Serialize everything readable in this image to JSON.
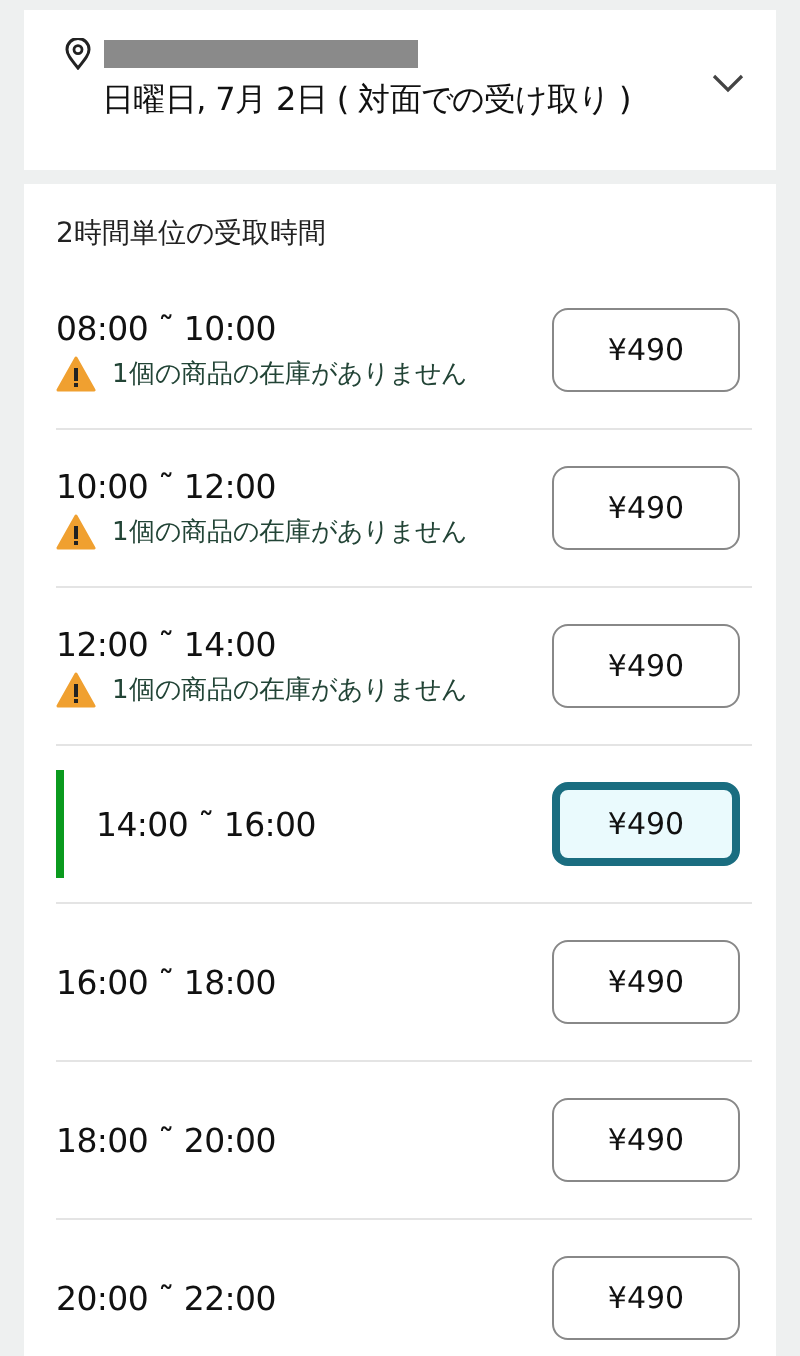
{
  "header": {
    "date": "日曜日, 7月 2日 ( 対面での受け取り )"
  },
  "section_title": "2時間単位の受取時間",
  "slots": [
    {
      "time": "08:00 ˜ 10:00",
      "warning": "1個の商品の在庫がありません",
      "price": "¥490",
      "selected": false
    },
    {
      "time": "10:00 ˜ 12:00",
      "warning": "1個の商品の在庫がありません",
      "price": "¥490",
      "selected": false
    },
    {
      "time": "12:00 ˜ 14:00",
      "warning": "1個の商品の在庫がありません",
      "price": "¥490",
      "selected": false
    },
    {
      "time": "14:00 ˜ 16:00",
      "price": "¥490",
      "selected": true
    },
    {
      "time": "16:00 ˜ 18:00",
      "price": "¥490",
      "selected": false
    },
    {
      "time": "18:00 ˜ 20:00",
      "price": "¥490",
      "selected": false
    },
    {
      "time": "20:00 ˜ 22:00",
      "price": "¥490",
      "selected": false
    }
  ]
}
